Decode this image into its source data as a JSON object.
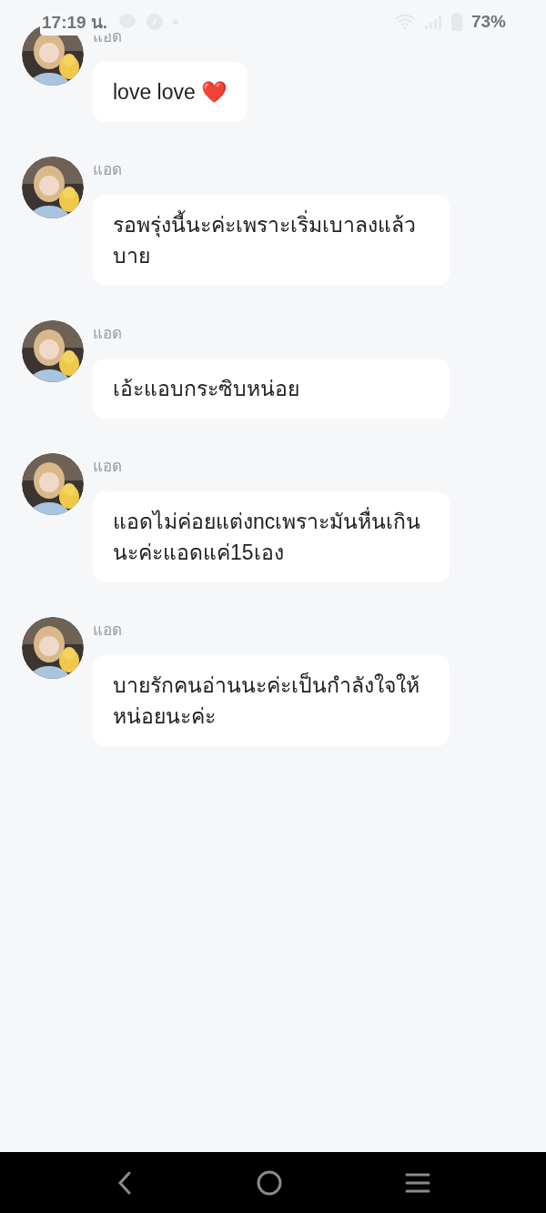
{
  "status_bar": {
    "time": "17:19 น.",
    "battery": "73%"
  },
  "messages": [
    {
      "sender": "แอด",
      "text": "love love ❤️"
    },
    {
      "sender": "แอด",
      "text": "รอพรุ่งนี้นะค่ะเพราะเริ่มเบาลงแล้วบาย"
    },
    {
      "sender": "แอด",
      "text": "เอ้ะแอบกระซิบหน่อย"
    },
    {
      "sender": "แอด",
      "text": "แอดไม่ค่อยแต่งncเพราะมันหื่นเกินนะค่ะแอดแค่15เอง"
    },
    {
      "sender": "แอด",
      "text": "บายรักคนอ่านนะค่ะเป็นกำลังใจให้หน่อยนะค่ะ"
    }
  ]
}
